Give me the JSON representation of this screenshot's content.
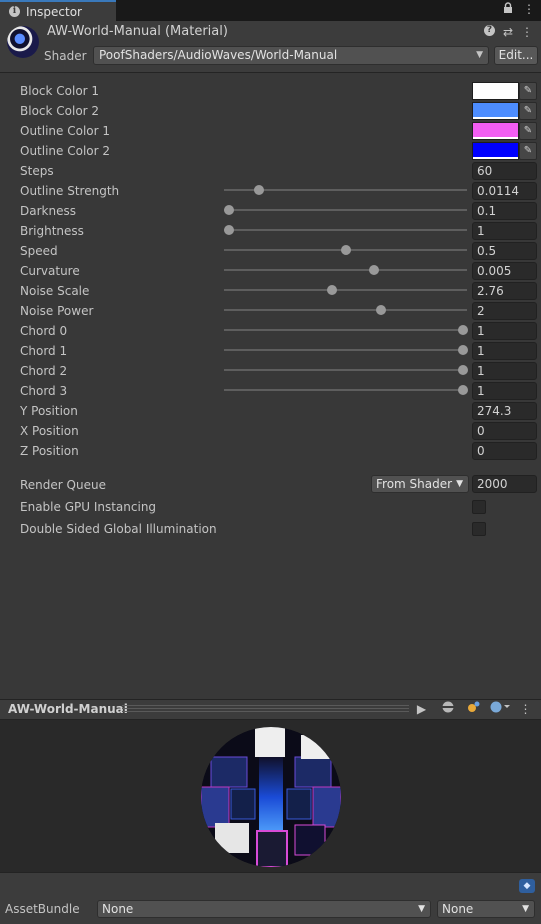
{
  "tab": {
    "title": "Inspector",
    "lock_icon": "lock-icon",
    "menu_icon": "kebab-menu-icon"
  },
  "header": {
    "title": "AW-World-Manual (Material)",
    "shader_label": "Shader",
    "shader_value": "PoofShaders/AudioWaves/World-Manual",
    "edit_label": "Edit...",
    "icons": [
      "help-icon",
      "preset-icon",
      "kebab-menu-icon"
    ]
  },
  "colors": [
    {
      "label": "Block Color 1",
      "hex": "#ffffff",
      "bar": "#ffffff"
    },
    {
      "label": "Block Color 2",
      "hex": "#4d8dff",
      "bar": "#ffffff"
    },
    {
      "label": "Outline Color 1",
      "hex": "#f25df2",
      "bar": "#ffffff"
    },
    {
      "label": "Outline Color 2",
      "hex": "#0000ff",
      "bar": "#ffffff"
    }
  ],
  "steps": {
    "label": "Steps",
    "value": "60"
  },
  "sliders": [
    {
      "label": "Outline Strength",
      "value": "0.0114",
      "level": 0.13
    },
    {
      "label": "Darkness",
      "value": "0.1",
      "level": 0.0
    },
    {
      "label": "Brightness",
      "value": "1",
      "level": 0.0
    },
    {
      "label": "Speed",
      "value": "0.5",
      "level": 0.5
    },
    {
      "label": "Curvature",
      "value": "0.005",
      "level": 0.62
    },
    {
      "label": "Noise Scale",
      "value": "2.76",
      "level": 0.44
    },
    {
      "label": "Noise Power",
      "value": "2",
      "level": 0.65
    },
    {
      "label": "Chord 0",
      "value": "1",
      "level": 1.0
    },
    {
      "label": "Chord 1",
      "value": "1",
      "level": 1.0
    },
    {
      "label": "Chord 2",
      "value": "1",
      "level": 1.0
    },
    {
      "label": "Chord 3",
      "value": "1",
      "level": 1.0
    }
  ],
  "positions": [
    {
      "label": "Y Position",
      "value": "274.3"
    },
    {
      "label": "X Position",
      "value": "0"
    },
    {
      "label": "Z Position",
      "value": "0"
    }
  ],
  "render_queue": {
    "label": "Render Queue",
    "mode": "From Shader",
    "value": "2000"
  },
  "gpu_instancing": {
    "label": "Enable GPU Instancing",
    "checked": false
  },
  "double_sided_gi": {
    "label": "Double Sided Global Illumination",
    "checked": false
  },
  "preview": {
    "title": "AW-World-Manual",
    "icons": [
      "play-icon",
      "sphere-mesh-icon",
      "lights-icon",
      "background-sphere-icon",
      "kebab-menu-icon"
    ]
  },
  "asset_bundle": {
    "label": "AssetBundle",
    "name": "None",
    "variant": "None"
  }
}
